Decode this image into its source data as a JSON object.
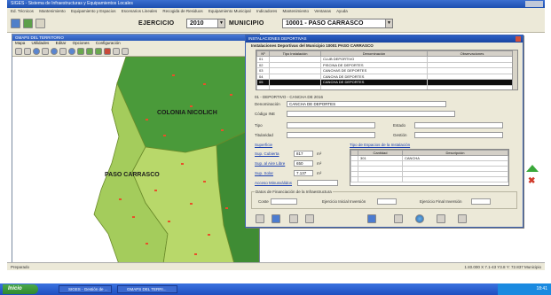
{
  "app": {
    "title": "SIGES - Sistema de Infraestructuras y Equipamientos Locales",
    "menu": [
      "Ed. Técnicos",
      "Mantenimiento",
      "Equipamiento y Espacios",
      "Escenarios Lineales",
      "Recogida de Residuos",
      "Equipamiento Municipal",
      "Indicadores",
      "Mantenimiento",
      "Ventanas",
      "Ayuda"
    ]
  },
  "selector": {
    "ejercicio_label": "EJERCICIO",
    "ejercicio_value": "2010",
    "municipio_label": "MUNICIPIO",
    "municipio_value": "10001 - PASO CARRASCO"
  },
  "map_window": {
    "title": "GMAPS DEL TERRITORIO",
    "menu": [
      "Mapa",
      "Utilidades",
      "Editar",
      "Opciones",
      "Configuración"
    ],
    "labels": {
      "north": "COLONIA NICOLICH",
      "south": "PASO CARRASCO"
    },
    "colors": {
      "north_zone": "#4a9a3a",
      "east_zone": "#3f8c34",
      "south_zone": "#b8d86a",
      "west_zone": "#a4cc5c",
      "border": "#6a8a2a",
      "markers": "#e8502a"
    }
  },
  "dialog": {
    "title": "INSTALACIONES DEPORTIVAS",
    "subtitle": "Instalaciones Deportivas del Municipio 10001 PASO CARRASCO",
    "table": {
      "columns": [
        "Nº",
        "Tipo Instalación",
        "Denominación",
        "Observaciones"
      ],
      "rows": [
        [
          "01",
          "",
          "CLUB DEPORTIVO",
          ""
        ],
        [
          "02",
          "",
          "PISCINA DE DEPORTES",
          ""
        ],
        [
          "03",
          "",
          "CANCHAS DE DEPORTES",
          ""
        ],
        [
          "04",
          "",
          "CANCHA DE DEPORTES",
          ""
        ],
        [
          "05",
          "",
          "CANCHA DE DEPORTES",
          ""
        ]
      ],
      "selected_row": 4
    },
    "detail": {
      "header": "01 - DEPORTIVO - CANCHA DE 2016",
      "denominacion_label": "Denominación",
      "denominacion_value": "CANCHA DE DEPORTES",
      "codigo_label": "Código INE",
      "tipo_label": "Tipo",
      "estado_label": "Estado",
      "titularidad_label": "Titularidad",
      "gestion_label": "Gestión",
      "superficie_label": "Superficie",
      "tipo_espacios_label": "Tipo de Espacios de la Instalación",
      "sup_cubierta_label": "Sup. Cubierta",
      "sup_cubierta_value": "817",
      "sup_aire_libre_label": "Sup. al Aire Libre",
      "sup_aire_libre_value": "650",
      "sup_solar_label": "Sup. Solar",
      "sup_solar_value": "7.137",
      "acceso_label": "Acceso Minusválidos",
      "sub_columns": [
        "Cantidad",
        "Descripción"
      ],
      "sub_rows": [
        [
          "301",
          "CANCHA"
        ]
      ],
      "datos_label": "Datos de Financiación de la Infraestructura",
      "coste_label": "Coste",
      "ejercicio_inicial_label": "Ejercicio Inicial Inversión",
      "ejercicio_final_label": "Ejercicio Final Inversión"
    }
  },
  "statusbar": {
    "left": "Preparado",
    "right": "1:40.000 X 7.1-43 Y3.8   Y: 72.837   Municipio"
  },
  "taskbar": {
    "start": "Inicio",
    "tasks": [
      "SIGES - Gestión de ...",
      "GMAPS DEL TERRI..."
    ],
    "clock": "18:41"
  }
}
